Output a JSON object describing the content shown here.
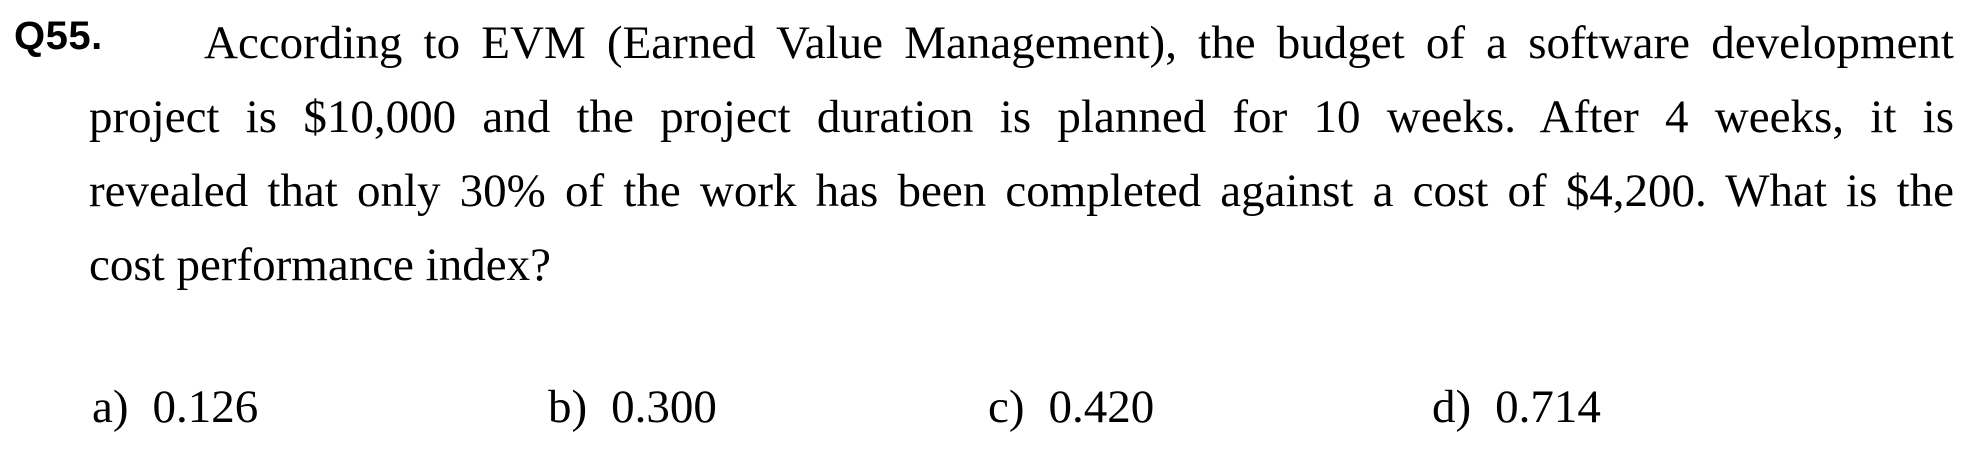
{
  "question": {
    "number": "Q55.",
    "lines": [
      "According to EVM (Earned Value Management), the budget of a software development",
      "project is $10,000 and the project duration is planned for 10 weeks. After 4 weeks, it is",
      "revealed that only 30% of the work has been completed against a cost of $4,200. What is the",
      "cost performance index?"
    ]
  },
  "options": [
    {
      "letter": "a)",
      "value": "0.126"
    },
    {
      "letter": "b)",
      "value": "0.300"
    },
    {
      "letter": "c)",
      "value": "0.420"
    },
    {
      "letter": "d)",
      "value": "0.714"
    }
  ]
}
